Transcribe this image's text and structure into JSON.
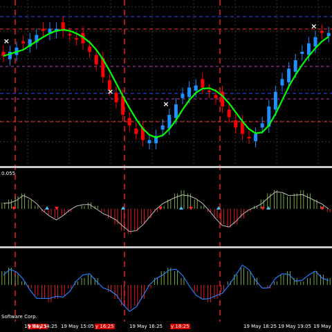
{
  "window": {
    "background": "#000000"
  },
  "subwindow_scale_label": "0.055",
  "footer_label": "Software Corp.",
  "time_axis": [
    {
      "label": "y 14:25",
      "highlight": true
    },
    {
      "label": "19 May 14:25",
      "highlight": false
    },
    {
      "label": "19 May 15:05",
      "highlight": false
    },
    {
      "label": "y 16:25",
      "highlight": true
    },
    {
      "label": "19 May 16:25",
      "highlight": false
    },
    {
      "label": "y 18:25",
      "highlight": true
    },
    {
      "label": "19 May 18:25",
      "highlight": false
    },
    {
      "label": "19 May 19:05",
      "highlight": false
    },
    {
      "label": "19 May",
      "highlight": false
    }
  ],
  "colors": {
    "bull_candle": "#1e90ff",
    "bear_candle": "#ff0000",
    "moving_average": "#00ff00",
    "signal_marker": "#ffffff",
    "vertical_marker": "#ff2020",
    "level_red": "#ff3030",
    "level_blue": "#3050ff",
    "level_purple": "#c040c0",
    "grid": "#505050",
    "hist_positive": "#7fbf3f",
    "hist_negative": "#ff2020",
    "osc_line": "#c0c0c0",
    "osc2_line": "#2080ff",
    "separator": "#c8c8c8",
    "arrow_up": "#40c0ff",
    "arrow_down": "#ff2020"
  },
  "chart_data": {
    "type": "candlestick",
    "close_series": [
      70,
      72,
      74,
      76,
      78,
      80,
      82,
      83,
      83,
      82,
      80,
      78,
      76,
      72,
      66,
      60,
      54,
      48,
      42,
      37,
      33,
      30,
      30,
      32,
      37,
      42,
      47,
      52,
      55,
      56,
      55,
      53,
      50,
      46,
      41,
      36,
      33,
      31,
      33,
      38,
      46,
      53,
      59,
      64,
      68,
      72,
      76,
      79,
      81,
      81
    ],
    "signal_points": [
      0.9,
      15.3,
      23.0,
      43.5
    ],
    "vertical_marker_positions": [
      2.0,
      12.3,
      28.2
    ],
    "histogram_1": [
      0.2,
      0.3,
      0.4,
      0.5,
      0.3,
      0.1,
      -0.1,
      -0.2,
      -0.3,
      -0.2,
      -0.1,
      0.0,
      0.1,
      0.2,
      0.1,
      -0.1,
      -0.3,
      -0.5,
      -0.7,
      -0.8,
      -0.7,
      -0.5,
      -0.3,
      -0.1,
      0.1,
      0.3,
      0.5,
      0.6,
      0.5,
      0.3,
      0.1,
      -0.1,
      -0.3,
      -0.5,
      -0.6,
      -0.5,
      -0.3,
      -0.1,
      0.1,
      0.3,
      0.5,
      0.6,
      0.5,
      0.4,
      0.5,
      0.6,
      0.5,
      0.3,
      0.1,
      -0.1
    ],
    "histogram_2": [
      0.4,
      0.5,
      0.3,
      0.1,
      -0.1,
      -0.3,
      -0.4,
      -0.5,
      -0.4,
      -0.3,
      -0.1,
      0.1,
      0.2,
      0.3,
      0.2,
      0.0,
      -0.2,
      -0.4,
      -0.6,
      -0.7,
      -0.6,
      -0.4,
      -0.1,
      0.2,
      0.4,
      0.5,
      0.4,
      0.2,
      0.0,
      -0.2,
      -0.4,
      -0.5,
      -0.4,
      -0.2,
      0.1,
      0.3,
      0.5,
      0.4,
      0.2,
      0.0,
      -0.1,
      0.1,
      0.3,
      0.4,
      0.2,
      0.1,
      0.2,
      0.4,
      0.3,
      0.2
    ]
  }
}
